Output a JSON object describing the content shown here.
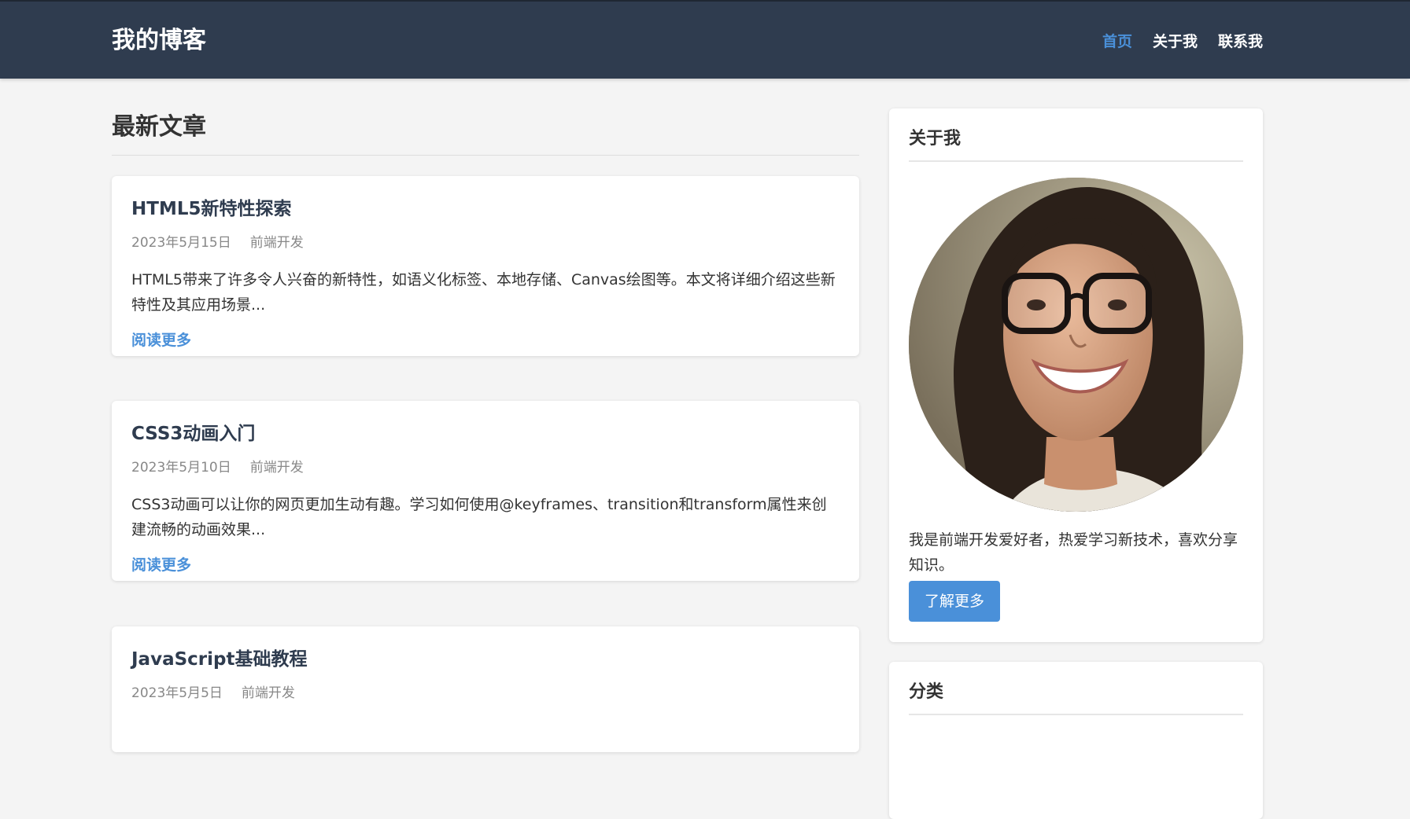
{
  "header": {
    "brand": "我的博客",
    "nav": [
      {
        "label": "首页",
        "active": true
      },
      {
        "label": "关于我",
        "active": false
      },
      {
        "label": "联系我",
        "active": false
      }
    ]
  },
  "main": {
    "section_title": "最新文章",
    "posts": [
      {
        "title": "HTML5新特性探索",
        "date": "2023年5月15日",
        "category": "前端开发",
        "excerpt": "HTML5带来了许多令人兴奋的新特性，如语义化标签、本地存储、Canvas绘图等。本文将详细介绍这些新特性及其应用场景...",
        "read_more": "阅读更多"
      },
      {
        "title": "CSS3动画入门",
        "date": "2023年5月10日",
        "category": "前端开发",
        "excerpt": "CSS3动画可以让你的网页更加生动有趣。学习如何使用@keyframes、transition和transform属性来创建流畅的动画效果...",
        "read_more": "阅读更多"
      },
      {
        "title": "JavaScript基础教程",
        "date": "2023年5月5日",
        "category": "前端开发"
      }
    ]
  },
  "sidebar": {
    "about": {
      "title": "关于我",
      "text": "我是前端开发爱好者，热爱学习新技术，喜欢分享知识。",
      "button": "了解更多"
    },
    "categories": {
      "title": "分类"
    }
  },
  "colors": {
    "header_bg": "#2f3c4f",
    "accent": "#4a90d9",
    "page_bg": "#f4f4f4"
  }
}
